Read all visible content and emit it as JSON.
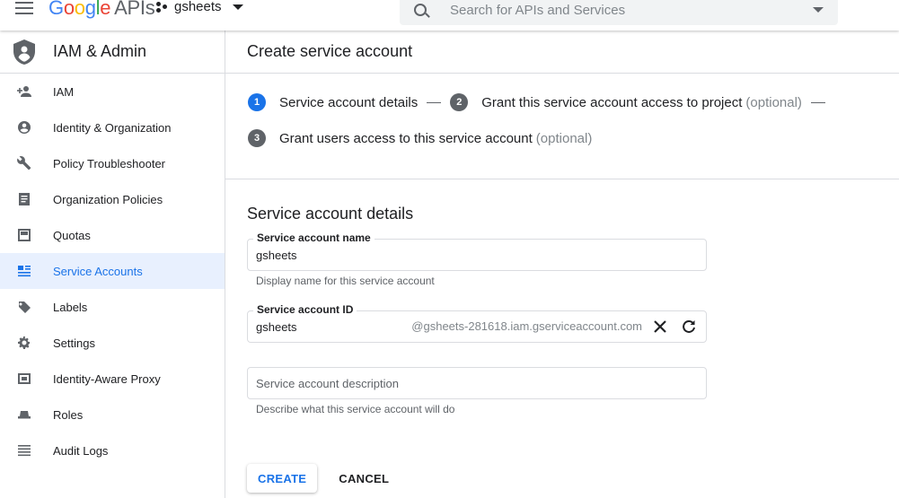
{
  "header": {
    "logo_google": [
      "G",
      "o",
      "o",
      "g",
      "l",
      "e"
    ],
    "logo_apis": "APIs",
    "project_name": "gsheets",
    "search_placeholder": "Search for APIs and Services"
  },
  "sidebar": {
    "title": "IAM & Admin",
    "items": [
      {
        "label": "IAM",
        "icon": "person-add-icon"
      },
      {
        "label": "Identity & Organization",
        "icon": "account-circle-icon"
      },
      {
        "label": "Policy Troubleshooter",
        "icon": "wrench-icon"
      },
      {
        "label": "Organization Policies",
        "icon": "document-icon"
      },
      {
        "label": "Quotas",
        "icon": "quota-icon"
      },
      {
        "label": "Service Accounts",
        "icon": "service-account-icon",
        "active": true
      },
      {
        "label": "Labels",
        "icon": "label-icon"
      },
      {
        "label": "Settings",
        "icon": "gear-icon"
      },
      {
        "label": "Identity-Aware Proxy",
        "icon": "proxy-icon"
      },
      {
        "label": "Roles",
        "icon": "hat-icon"
      },
      {
        "label": "Audit Logs",
        "icon": "list-icon"
      }
    ]
  },
  "main": {
    "page_title": "Create service account",
    "steps": [
      {
        "number": "1",
        "label": "Service account details",
        "optional": ""
      },
      {
        "number": "2",
        "label": "Grant this service account access to project",
        "optional": "(optional)"
      },
      {
        "number": "3",
        "label": "Grant users access to this service account",
        "optional": "(optional)"
      }
    ],
    "section_title": "Service account details",
    "name_field": {
      "label": "Service account name",
      "value": "gsheets",
      "hint": "Display name for this service account"
    },
    "id_field": {
      "label": "Service account ID",
      "value": "gsheets",
      "suffix": "@gsheets-281618.iam.gserviceaccount.com"
    },
    "description_field": {
      "placeholder": "Service account description",
      "hint": "Describe what this service account will do"
    },
    "create_label": "CREATE",
    "cancel_label": "CANCEL"
  },
  "colors": {
    "accent": "#1a73e8",
    "active_bg": "#e8f0fe",
    "divider": "#dadce0"
  }
}
